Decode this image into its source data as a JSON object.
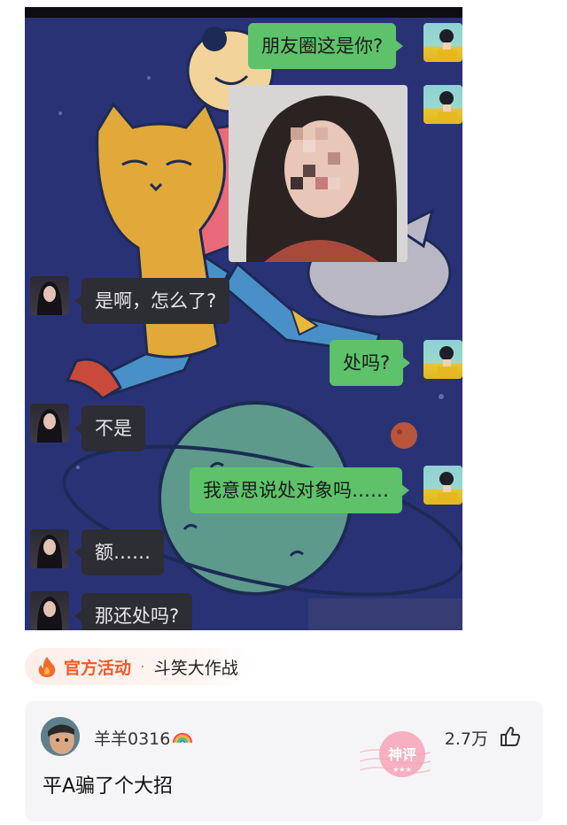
{
  "chat": {
    "messages": [
      {
        "side": "me",
        "text": "朋友圈这是你?"
      },
      {
        "side": "me",
        "type": "image"
      },
      {
        "side": "her",
        "text": "是啊，怎么了?"
      },
      {
        "side": "me",
        "text": "处吗?"
      },
      {
        "side": "her",
        "text": "不是"
      },
      {
        "side": "me",
        "text": "我意思说处对象吗……"
      },
      {
        "side": "her",
        "text": "额……"
      },
      {
        "side": "her",
        "text": "那还处吗?"
      }
    ]
  },
  "activity": {
    "icon": "fire-icon",
    "title": "官方活动",
    "separator": "·",
    "name": "斗笑大作战"
  },
  "comment": {
    "username": "羊羊0316",
    "badge": "rainbow-icon",
    "text": "平A骗了个大招",
    "likes": "2.7万",
    "stamp": "神评"
  },
  "colors": {
    "bubble_me": "#5dc26a",
    "bubble_her": "#2d2d34",
    "chat_bg": "#2a3276",
    "activity_accent": "#f15a2a",
    "stamp": "#f08fa8"
  }
}
